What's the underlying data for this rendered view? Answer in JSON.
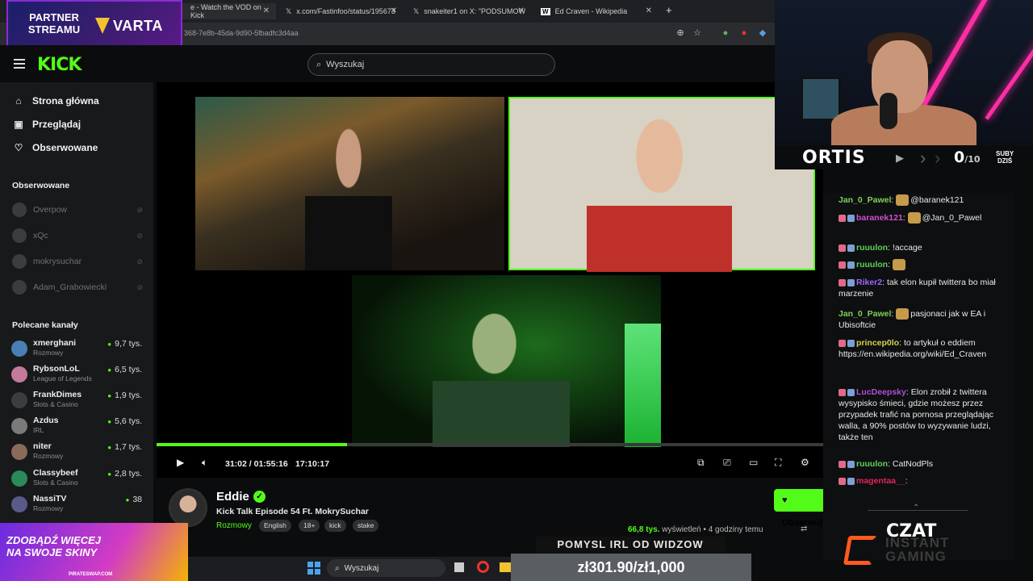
{
  "browser": {
    "tabs": [
      {
        "label": "e - Watch the VOD on Kick",
        "active": true
      },
      {
        "label": "x.com/Fastinfoo/status/195673",
        "active": false
      },
      {
        "label": "snakeiter1 on X: \"PODSUMOW",
        "active": false
      },
      {
        "label": "Ed Craven - Wikipedia",
        "active": false
      }
    ],
    "url": "368-7e8b-45da-9d90-5fbadfc3d4aa"
  },
  "partner_banner": {
    "line1": "PARTNER",
    "line2": "STREAMU",
    "brand": "VARTA"
  },
  "kick": {
    "logo": "KICK",
    "search_placeholder": "Wyszukaj",
    "nav": [
      {
        "label": "Strona główna",
        "icon": "home-icon"
      },
      {
        "label": "Przeglądaj",
        "icon": "browse-icon"
      },
      {
        "label": "Obserwowane",
        "icon": "heart-icon"
      }
    ],
    "followed_title": "Obserwowane",
    "followed": [
      "Overpow",
      "xQc",
      "mokrysuchar",
      "Adam_Grabowiecki"
    ],
    "recommended_title": "Polecane kanały",
    "recommended": [
      {
        "name": "xmerghani",
        "category": "Rozmowy",
        "viewers": "9,7 tys.",
        "color": "#4a7fb5"
      },
      {
        "name": "RybsonLoL",
        "category": "League of Legends",
        "viewers": "6,5 tys.",
        "color": "#c47a9a"
      },
      {
        "name": "FrankDimes",
        "category": "Slots & Casino",
        "viewers": "1,9 tys.",
        "color": "#3d3d3d"
      },
      {
        "name": "Azdus",
        "category": "IRL",
        "viewers": "5,6 tys.",
        "color": "#7a7a7a"
      },
      {
        "name": "niter",
        "category": "Rozmowy",
        "viewers": "1,7 tys.",
        "color": "#8a6a5a"
      },
      {
        "name": "Classybeef",
        "category": "Slots & Casino",
        "viewers": "2,8 tys.",
        "color": "#2a8a5a"
      },
      {
        "name": "NassiTV",
        "category": "Rozmowy",
        "viewers": "38",
        "color": "#5a5a8a"
      }
    ]
  },
  "player": {
    "current_time": "31:02",
    "separator": "/",
    "duration": "01:55:16",
    "clock": "17:10:17",
    "progress_fraction": 0.286
  },
  "stream": {
    "username": "Eddie",
    "title": "Kick Talk Episode 54 Ft. MokrySuchar",
    "category": "Rozmowy",
    "tags": [
      "English",
      "18+",
      "kick",
      "stake"
    ],
    "follow_label": "Obserwuj",
    "views_count": "66,8 tys.",
    "views_label": "wyświetleń",
    "bullet": "•",
    "time_ago": "4 godziny temu"
  },
  "overlay": {
    "streamer_name": "ORTIS",
    "subs_current": "0",
    "subs_goal": "/10",
    "subs_label1": "SUBY",
    "subs_label2": "DZIŚ",
    "idea_title": "POMYSL IRL OD WIDZOW",
    "idea_goal": "zł301.90/zł1,000",
    "chat_label": "CZAT",
    "sponsor_line1": "INSTANT",
    "sponsor_line2": "GAMING",
    "ad_line1": "ZDOBĄDŹ WIĘCEJ",
    "ad_line2": "NA SWOJE SKINY",
    "ad_site": "PIRATESWAP.COM"
  },
  "chat": [
    {
      "user": "Jan_0_Pawel",
      "color": "#7fd15a",
      "text": "@baranek121"
    },
    {
      "user": "baranek121",
      "color": "#d14fd6",
      "text": "@Jan_0_Pawel"
    },
    {
      "user": "ruuulon",
      "color": "#5ed15a",
      "text": "!accage"
    },
    {
      "user": "ruuulon",
      "color": "#5ed15a",
      "text": ""
    },
    {
      "user": "Riker2",
      "color": "#a066ff",
      "text": "tak elon kupił twittera bo miał marzenie"
    },
    {
      "user": "Jan_0_Pawel",
      "color": "#7fd15a",
      "text": "pasjonaci jak w EA i Ubisoftcie"
    },
    {
      "user": "princep0lo",
      "color": "#d6d14f",
      "text": "to artykuł o eddiem https://en.wikipedia.org/wiki/Ed_Craven"
    },
    {
      "user": "LucDeepsky",
      "color": "#b04fd6",
      "text": "Elon zrobił z twittera wysypisko śmieci, gdzie możesz przez przypadek trafić na pornosa przeglądając walla, a 90% postów to wyzywanie ludzi, także ten"
    },
    {
      "user": "ruuulon",
      "color": "#5ed15a",
      "text": "CatNodPls"
    },
    {
      "user": "magentaa__",
      "color": "#e0245e",
      "text": ""
    }
  ],
  "taskbar": {
    "search_placeholder": "Wyszukaj"
  },
  "colors": {
    "accent": "#53fc18",
    "sidebar": "#18191b",
    "background": "#0b0c0d"
  }
}
